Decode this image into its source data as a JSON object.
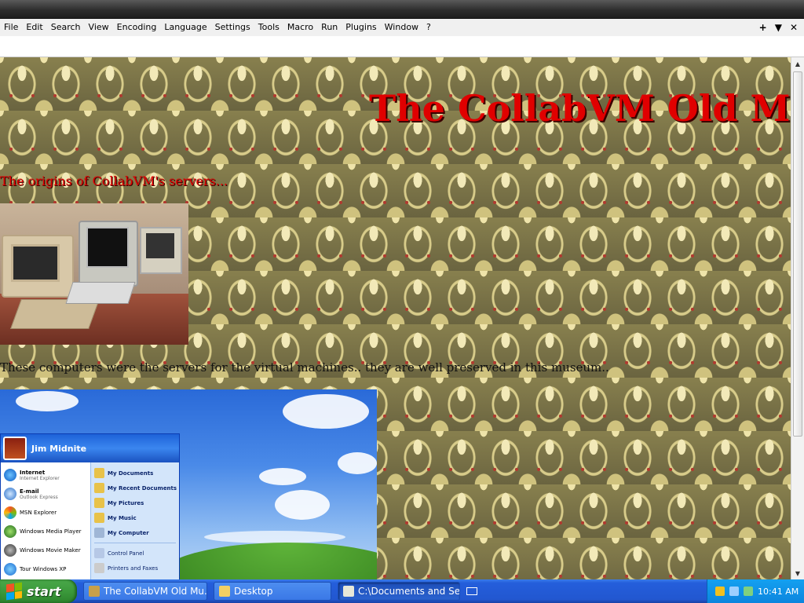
{
  "menu": {
    "items": [
      "File",
      "Edit",
      "Search",
      "View",
      "Encoding",
      "Language",
      "Settings",
      "Tools",
      "Macro",
      "Run",
      "Plugins",
      "Window",
      "?"
    ],
    "controls": [
      "+",
      "▼",
      "✕"
    ]
  },
  "page": {
    "heading": "The CollabVM Old Muse",
    "subheading": "The origins of CollabVM's servers...",
    "caption": "These computers were the servers for the virtual machines.. they are well preserved in this museum.."
  },
  "start_menu": {
    "user": "Jim Midnite",
    "left_items": [
      {
        "title": "Internet",
        "sub": "Internet Explorer"
      },
      {
        "title": "E-mail",
        "sub": "Outlook Express"
      },
      {
        "title": "MSN Explorer",
        "sub": ""
      },
      {
        "title": "Windows Media Player",
        "sub": ""
      },
      {
        "title": "Windows Movie Maker",
        "sub": ""
      },
      {
        "title": "Tour Windows XP",
        "sub": ""
      }
    ],
    "right_items": [
      "My Documents",
      "My Recent Documents",
      "My Pictures",
      "My Music",
      "My Computer"
    ],
    "right_items_light": [
      "Control Panel",
      "Printers and Faxes"
    ]
  },
  "taskbar": {
    "start_label": "start",
    "tasks": [
      "The CollabVM Old Mu...",
      "Desktop",
      "C:\\Documents and Se..."
    ],
    "clock": "10:41 AM"
  },
  "colors": {
    "heading_red": "#e00000",
    "xp_blue": "#245edb",
    "start_green": "#3c9a3c"
  }
}
